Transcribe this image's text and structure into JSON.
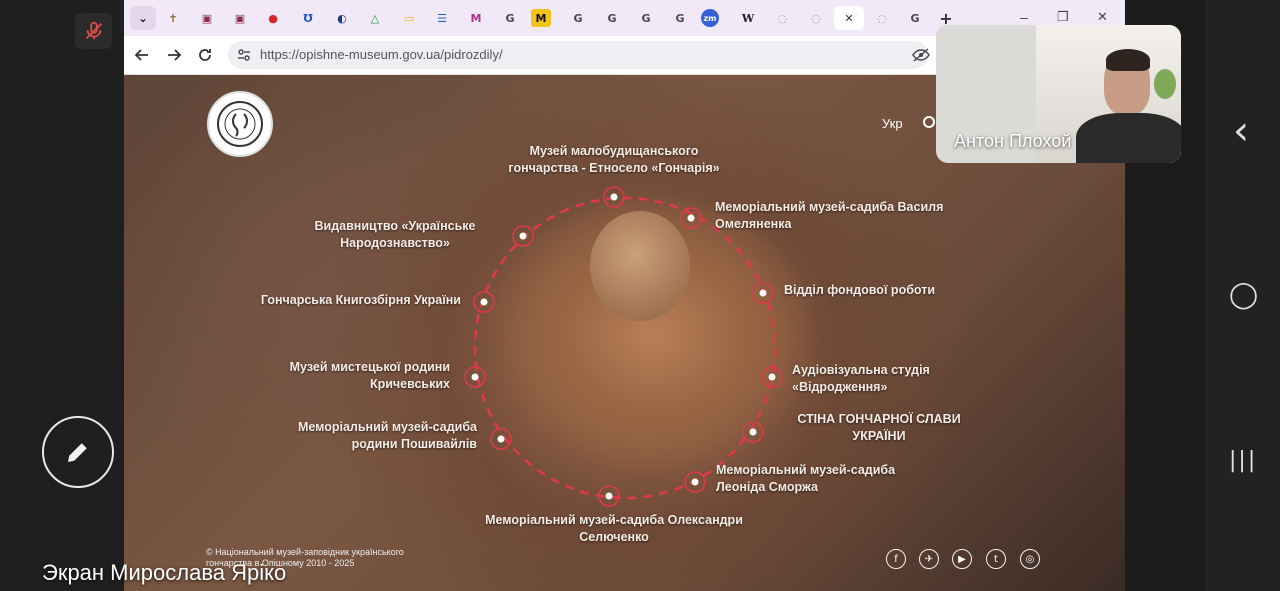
{
  "browser": {
    "url": "https://opishne-museum.gov.ua/pidrozdily/",
    "tabs": [
      "⌄",
      "✝",
      "▣",
      "▣",
      "●",
      "Ʊ",
      "◐",
      "△",
      "▭",
      "☰",
      "M",
      "G",
      "M",
      "G",
      "G",
      "G",
      "G",
      "zm",
      "W",
      "◌",
      "◌",
      "✕",
      "◌",
      "G",
      "+"
    ],
    "window_controls": {
      "minimize": "–",
      "restore": "❐",
      "close": "✕"
    }
  },
  "site": {
    "lang": "Укр",
    "copyright_line1": "© Національний музей-заповідник українського",
    "copyright_line2": "гончарства в Опішному 2010 - 2025",
    "divisions": {
      "d1": {
        "l1": "Музей малобудищанського",
        "l2": "гончарства - Етносело «Гончарія»"
      },
      "d2": {
        "l1": "Меморіальний музей-садиба Василя",
        "l2": "Омеляненка"
      },
      "d3": {
        "l1": "Відділ фондової роботи"
      },
      "d4": {
        "l1": "Аудіовізуальна студія",
        "l2": "«Відродження»"
      },
      "d5": {
        "l1": "СТІНА ГОНЧАРНОЇ СЛАВИ",
        "l2": "УКРАЇНИ"
      },
      "d6": {
        "l1": "Меморіальний музей-садиба",
        "l2": "Леоніда Сморжа"
      },
      "d7": {
        "l1": "Меморіальний музей-садиба Олександри",
        "l2": "Селюченко"
      },
      "d8": {
        "l1": "Меморіальний музей-садиба",
        "l2": "родини Пошивайлів"
      },
      "d9": {
        "l1": "Музей мистецької родини",
        "l2": "Кричевських"
      },
      "d10": {
        "l1": "Гончарська Книгозбірня України"
      },
      "d11": {
        "l1": "Видавництво «Українське",
        "l2": "Народознавство»"
      }
    },
    "social": [
      "f",
      "✈",
      "▶",
      "t",
      "◎"
    ]
  },
  "call": {
    "participant_name": "Антон Плохой",
    "screen_caption": "Экран Мирослава Ярiко"
  },
  "android_nav": {
    "back": "‹",
    "home": "◯",
    "recents": "|||"
  },
  "colors": {
    "accent": "#e0394a",
    "tabstrip": "#f1e9f7"
  }
}
